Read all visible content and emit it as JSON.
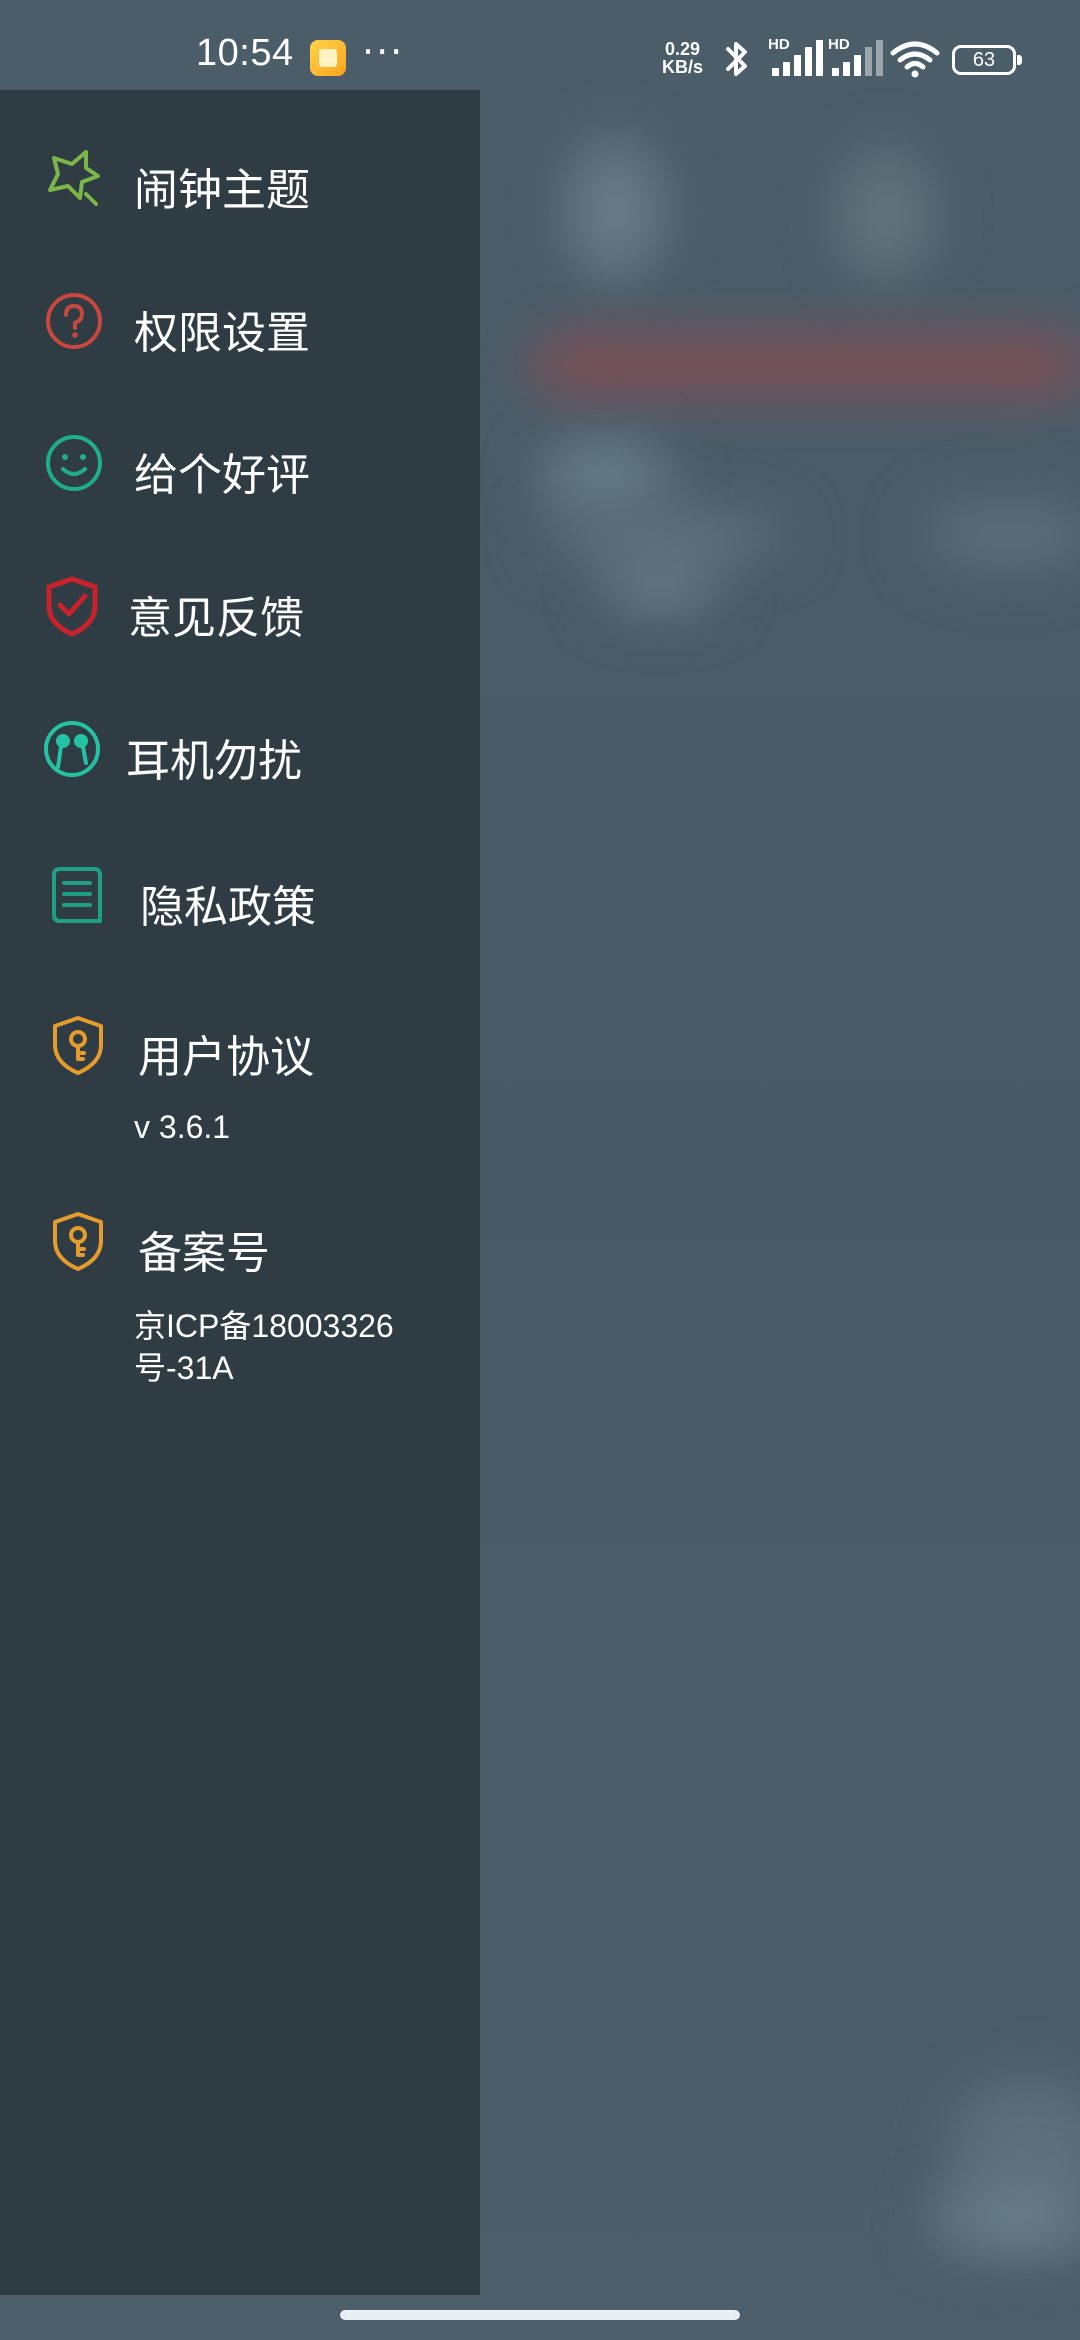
{
  "status_bar": {
    "time": "10:54",
    "more": "···",
    "net_speed_value": "0.29",
    "net_speed_unit": "KB/s",
    "signal_badge_1": "HD",
    "signal_badge_2": "HD",
    "battery": "63"
  },
  "drawer": {
    "items": [
      {
        "label": "闹钟主题",
        "icon": "star-outline-icon",
        "color": "#7ab648"
      },
      {
        "label": "权限设置",
        "icon": "question-circle-icon",
        "color": "#c8473e"
      },
      {
        "label": "给个好评",
        "icon": "smile-icon",
        "color": "#1fae8b"
      },
      {
        "label": "意见反馈",
        "icon": "shield-check-icon",
        "color": "#c8222b"
      },
      {
        "label": "耳机勿扰",
        "icon": "earphones-icon",
        "color": "#23c2a3"
      },
      {
        "label": "隐私政策",
        "icon": "document-icon",
        "color": "#1e9f86"
      },
      {
        "label": "用户协议",
        "icon": "shield-key-icon",
        "color": "#e69b2d"
      },
      {
        "label": "备案号",
        "icon": "shield-key-icon",
        "color": "#e69b2d"
      }
    ],
    "version": "v 3.6.1",
    "icp_line1": "京ICP备18003326",
    "icp_line2": "号-31A"
  }
}
